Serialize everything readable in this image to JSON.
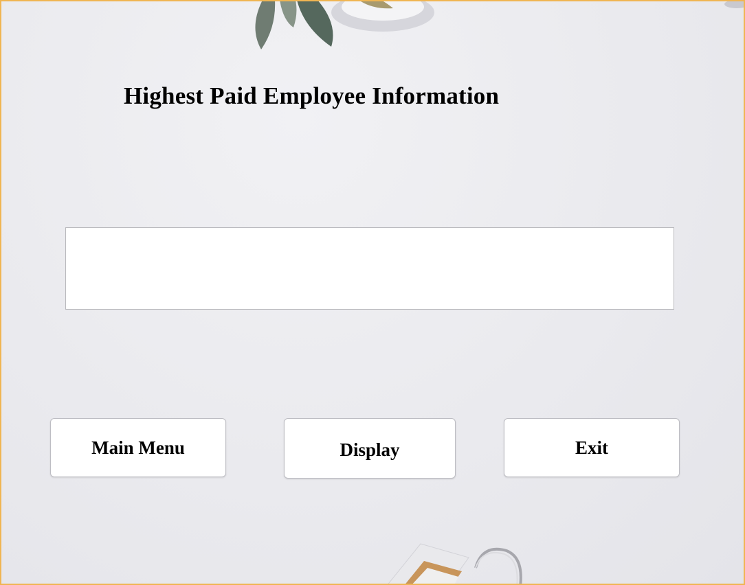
{
  "page": {
    "title": "Highest Paid Employee Information"
  },
  "output": {
    "value": ""
  },
  "buttons": {
    "main_menu": "Main Menu",
    "display": "Display",
    "exit": "Exit"
  },
  "colors": {
    "window_border": "#f0b552",
    "background": "#eaeaee"
  }
}
